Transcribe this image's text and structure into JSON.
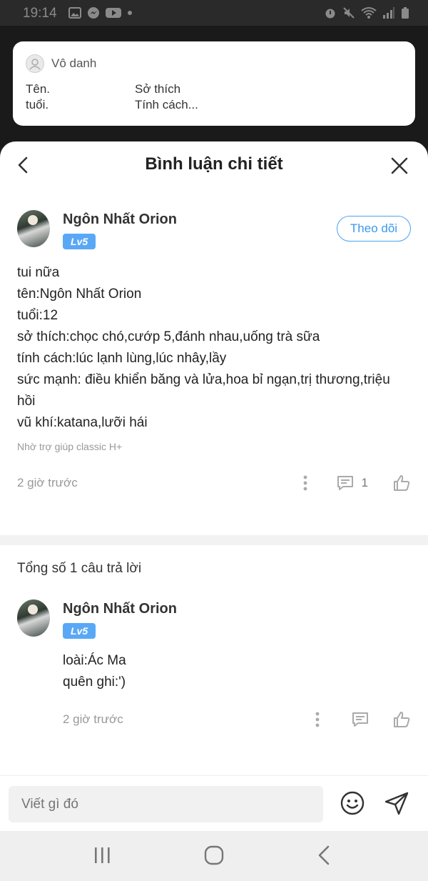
{
  "status_bar": {
    "time": "19:14",
    "left_icons": [
      "image-icon",
      "messenger-icon",
      "youtube-icon",
      "dot-icon"
    ],
    "right_icons": [
      "alarm-icon",
      "mute-icon",
      "wifi-icon",
      "signal-icon",
      "battery-icon"
    ]
  },
  "preview": {
    "name": "Vô danh",
    "rows": [
      {
        "left": "Tên.",
        "right": "Sở thích"
      },
      {
        "left": "tuổi.",
        "right": "Tính cách..."
      }
    ]
  },
  "sheet": {
    "title": "Bình luận chi tiết"
  },
  "comment": {
    "author": "Ngôn Nhất Orion",
    "level": "Lv5",
    "follow_label": "Theo dõi",
    "body": "tui nữa\ntên:Ngôn Nhất Orion\ntuổi:12\nsở thích:chọc chó,cướp 5,đánh nhau,uống trà sữa\ntính cách:lúc lạnh lùng,lúc nhây,lầy\nsức mạnh: điều khiển băng và lửa,hoa bỉ ngạn,trị thương,triệu hồi\nvũ khí:katana,lưỡi hái",
    "footer_note": "Nhờ trợ giúp classic H+",
    "time": "2 giờ trước",
    "reply_count": "1"
  },
  "replies": {
    "total_label": "Tổng số 1 câu trả lời",
    "items": [
      {
        "author": "Ngôn Nhất Orion",
        "level": "Lv5",
        "body": "loài:Ác Ma\nquên ghi:')",
        "time": "2 giờ trước"
      }
    ]
  },
  "input": {
    "placeholder": "Viết gì đó"
  },
  "colors": {
    "accent": "#4aa3f2",
    "badge": "#59a8f6"
  }
}
